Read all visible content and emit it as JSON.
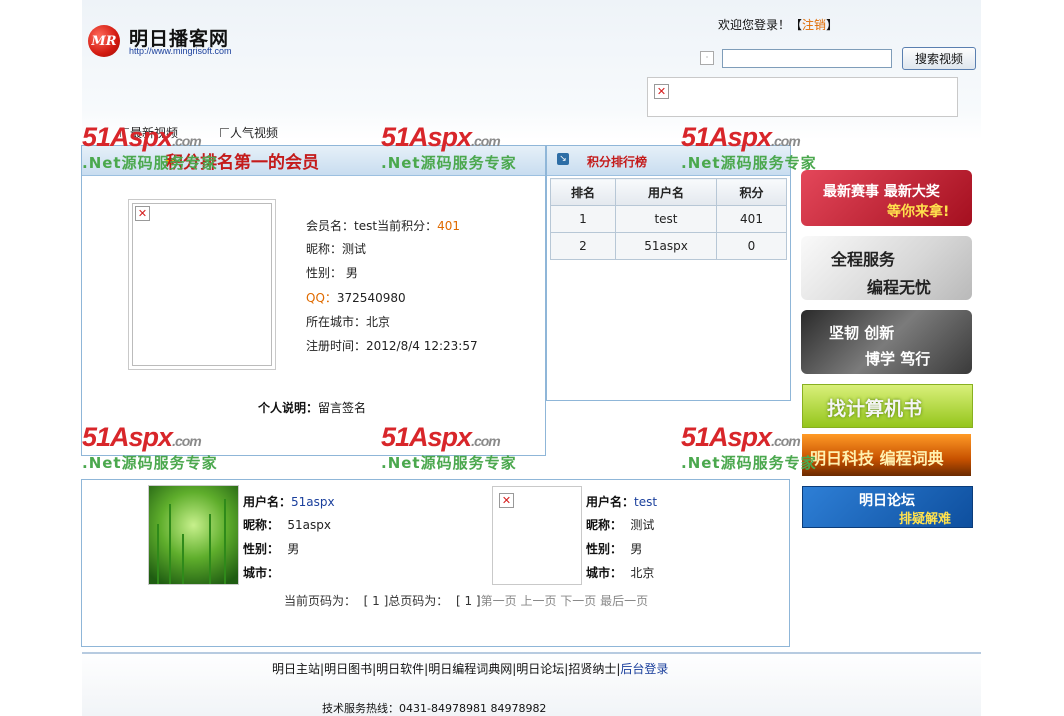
{
  "site": {
    "logo_mark": "MR",
    "title": "明日播客网",
    "url": "http://www.mingrisoft.com"
  },
  "login": {
    "prefix": "欢迎您登录！【",
    "link": "注销",
    "suffix": "】"
  },
  "search": {
    "value": "",
    "button": "搜索视频"
  },
  "tabs": [
    "最新视频",
    "人气视频"
  ],
  "watermark": {
    "brand_red": "51Aspx",
    "brand_domain": ".com",
    "slogan": ".Net源码服务专家"
  },
  "top_member": {
    "title": "积分排名第一的会员",
    "name_label": "会员名：",
    "name": "test",
    "score_label": "当前积分：",
    "score": "401",
    "nickname_label": "昵称：",
    "nickname": "测试",
    "gender_label": "性别：",
    "gender": "男",
    "qq_label": "QQ：",
    "qq": "372540980",
    "city_label": "所在城市：",
    "city": "北京",
    "regtime_label": "注册时间：",
    "regtime": "2012/8/4 12:23:57",
    "personal_label": "个人说明：",
    "personal": "留言签名"
  },
  "ranking": {
    "title": "积分排行榜",
    "headers": [
      "排名",
      "用户名",
      "积分"
    ],
    "rows": [
      [
        "1",
        "test",
        "401"
      ],
      [
        "2",
        "51aspx",
        "0"
      ]
    ]
  },
  "ads": {
    "ad1_line1": "最新赛事  最新大奖",
    "ad1_line2": "等你来拿!",
    "ad2_line1": "全程服务",
    "ad2_line2": "编程无忧",
    "ad3_line1": "坚韧 创新",
    "ad3_line2": "博学 笃行",
    "ad4": "找计算机书",
    "ad5": "明日科技 编程词典",
    "ad6_line1": "明日论坛",
    "ad6_line2": "排疑解难"
  },
  "members": [
    {
      "username_label": "用户名：",
      "username": "51aspx",
      "nickname_label": "昵称：",
      "nickname": "51aspx",
      "gender_label": "性别：",
      "gender": "男",
      "city_label": "城市：",
      "city": ""
    },
    {
      "username_label": "用户名：",
      "username": "test",
      "nickname_label": "昵称：",
      "nickname": "测试",
      "gender_label": "性别：",
      "gender": "男",
      "city_label": "城市：",
      "city": "北京"
    }
  ],
  "pager": {
    "current_label": "当前页码为：",
    "current": "[ 1 ]",
    "total_label": "总页码为：",
    "total": "[ 1 ]",
    "first": "第一页",
    "prev": "上一页",
    "next": "下一页",
    "last": "最后一页"
  },
  "footer": {
    "links": [
      "明日主站",
      "明日图书",
      "明日软件",
      "明日编程词典网",
      "明日论坛",
      "招贤纳士"
    ],
    "admin_link": "后台登录",
    "hotline": "技术服务热线：0431-84978981  84978982"
  }
}
